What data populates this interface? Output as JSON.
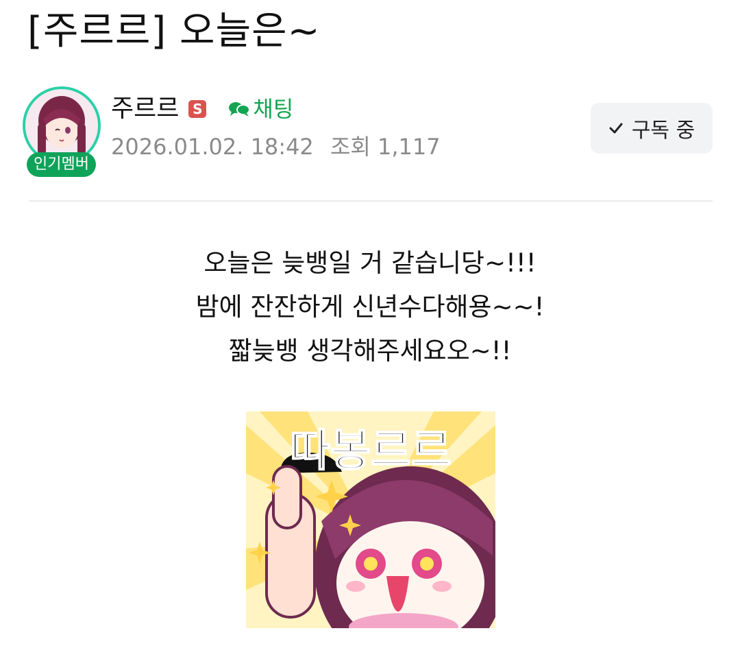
{
  "post": {
    "title": "[주르르] 오늘은~",
    "body_lines": [
      "오늘은 늦뱅일 거 같습니당~!!!",
      "밤에 잔잔하게 신년수다해용~~!",
      "짧늦뱅 생각해주세요오~!!"
    ],
    "sticker_text": "따봉르르"
  },
  "author": {
    "name": "주르르",
    "level_badge": "S",
    "member_badge": "인기멤버",
    "chat_label": "채팅",
    "date": "2026.01.02. 18:42",
    "views": "조회 1,117"
  },
  "subscribe": {
    "label": "구독 중"
  },
  "colors": {
    "accent_green": "#11a552",
    "badge_green": "#0fa35a",
    "avatar_ring": "#2bd0a8",
    "s_badge": "#d9534f"
  }
}
